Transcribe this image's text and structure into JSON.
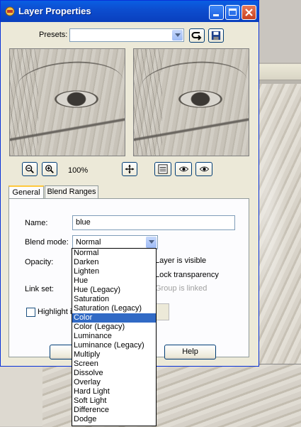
{
  "window": {
    "title": "Layer Properties"
  },
  "presets": {
    "label": "Presets:",
    "value": ""
  },
  "zoom": {
    "level": "100%"
  },
  "tabs": [
    {
      "label": "General",
      "active": true
    },
    {
      "label": "Blend Ranges",
      "active": false
    }
  ],
  "general": {
    "name_label": "Name:",
    "name_value": "blue",
    "blend_label": "Blend mode:",
    "blend_value": "Normal",
    "opacity_label": "Opacity:",
    "link_label": "Link set:",
    "highlight_label": "Highlight i",
    "layer_visible_label": "Layer is visible",
    "lock_label": "Lock transparency",
    "group_label": "Group is linked"
  },
  "buttons": {
    "help": "Help"
  },
  "blend_modes": [
    "Normal",
    "Darken",
    "Lighten",
    "Hue",
    "Hue (Legacy)",
    "Saturation",
    "Saturation (Legacy)",
    "Color",
    "Color (Legacy)",
    "Luminance",
    "Luminance (Legacy)",
    "Multiply",
    "Screen",
    "Dissolve",
    "Overlay",
    "Hard Light",
    "Soft Light",
    "Difference",
    "Dodge"
  ],
  "selected_blend_mode": "Color",
  "colors": {
    "title_bar": "#0a4fd0",
    "selection": "#316ac5",
    "dialog_bg": "#ece9d8"
  }
}
